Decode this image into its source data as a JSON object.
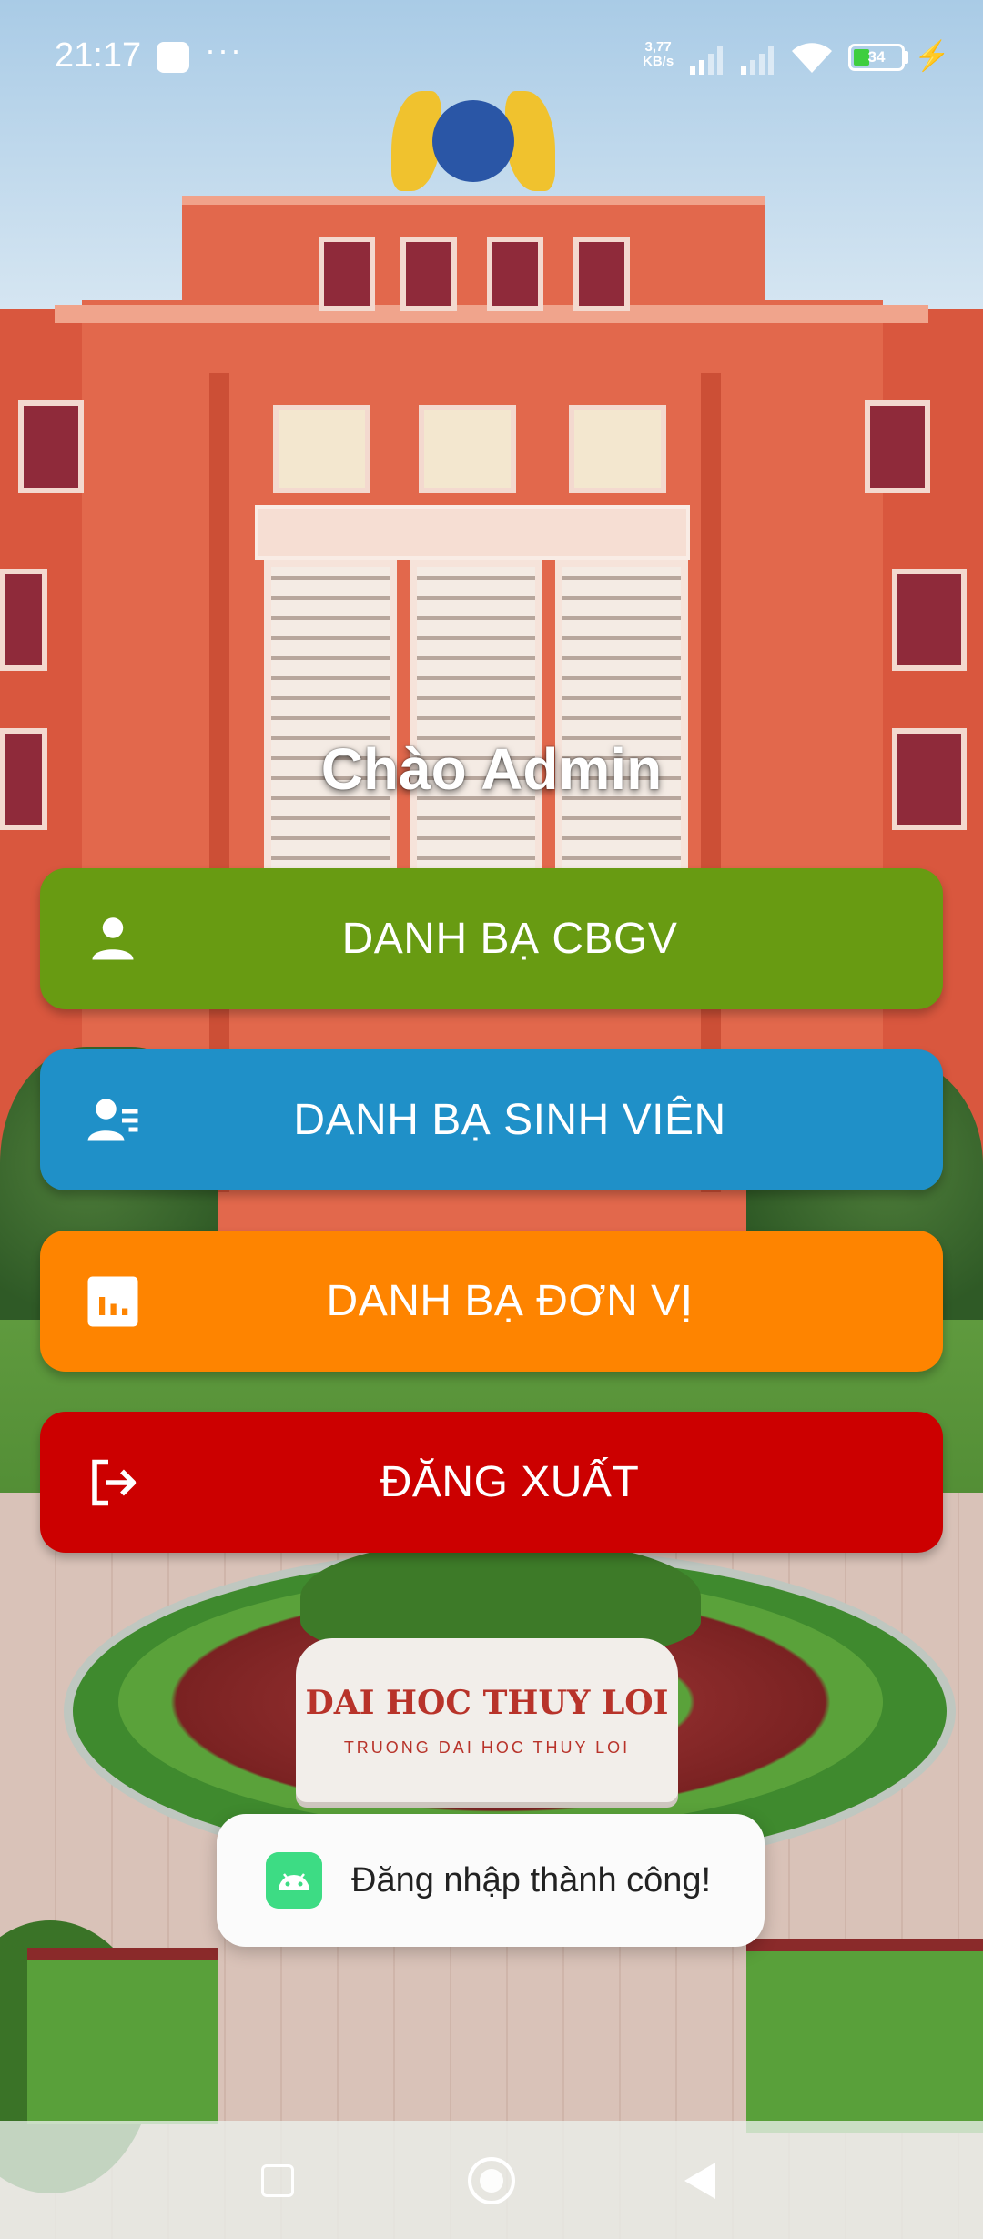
{
  "status_bar": {
    "time": "21:17",
    "more": "···",
    "net_speed_value": "3,77",
    "net_speed_unit": "KB/s",
    "battery_level": "34",
    "battery_fraction": 0.34
  },
  "background": {
    "stone_title": "DAI HOC THUY LOI",
    "stone_subtitle": "TRUONG DAI HOC THUY LOI"
  },
  "greeting": "Chào Admin",
  "menu": [
    {
      "label": "DANH BẠ CBGV",
      "icon": "person-icon",
      "color": "#689b12"
    },
    {
      "label": "DANH BẠ SINH VIÊN",
      "icon": "person-list-icon",
      "color": "#1f90c8"
    },
    {
      "label": "DANH BẠ ĐƠN VỊ",
      "icon": "bar-chart-icon",
      "color": "#fe8400"
    },
    {
      "label": "ĐĂNG XUẤT",
      "icon": "logout-icon",
      "color": "#cc0000"
    }
  ],
  "toast": {
    "icon": "android-icon",
    "message": "Đăng nhập thành công!"
  },
  "nav_bar": {
    "recents": "square-icon",
    "home": "circle-home-icon",
    "back": "triangle-back-icon"
  }
}
